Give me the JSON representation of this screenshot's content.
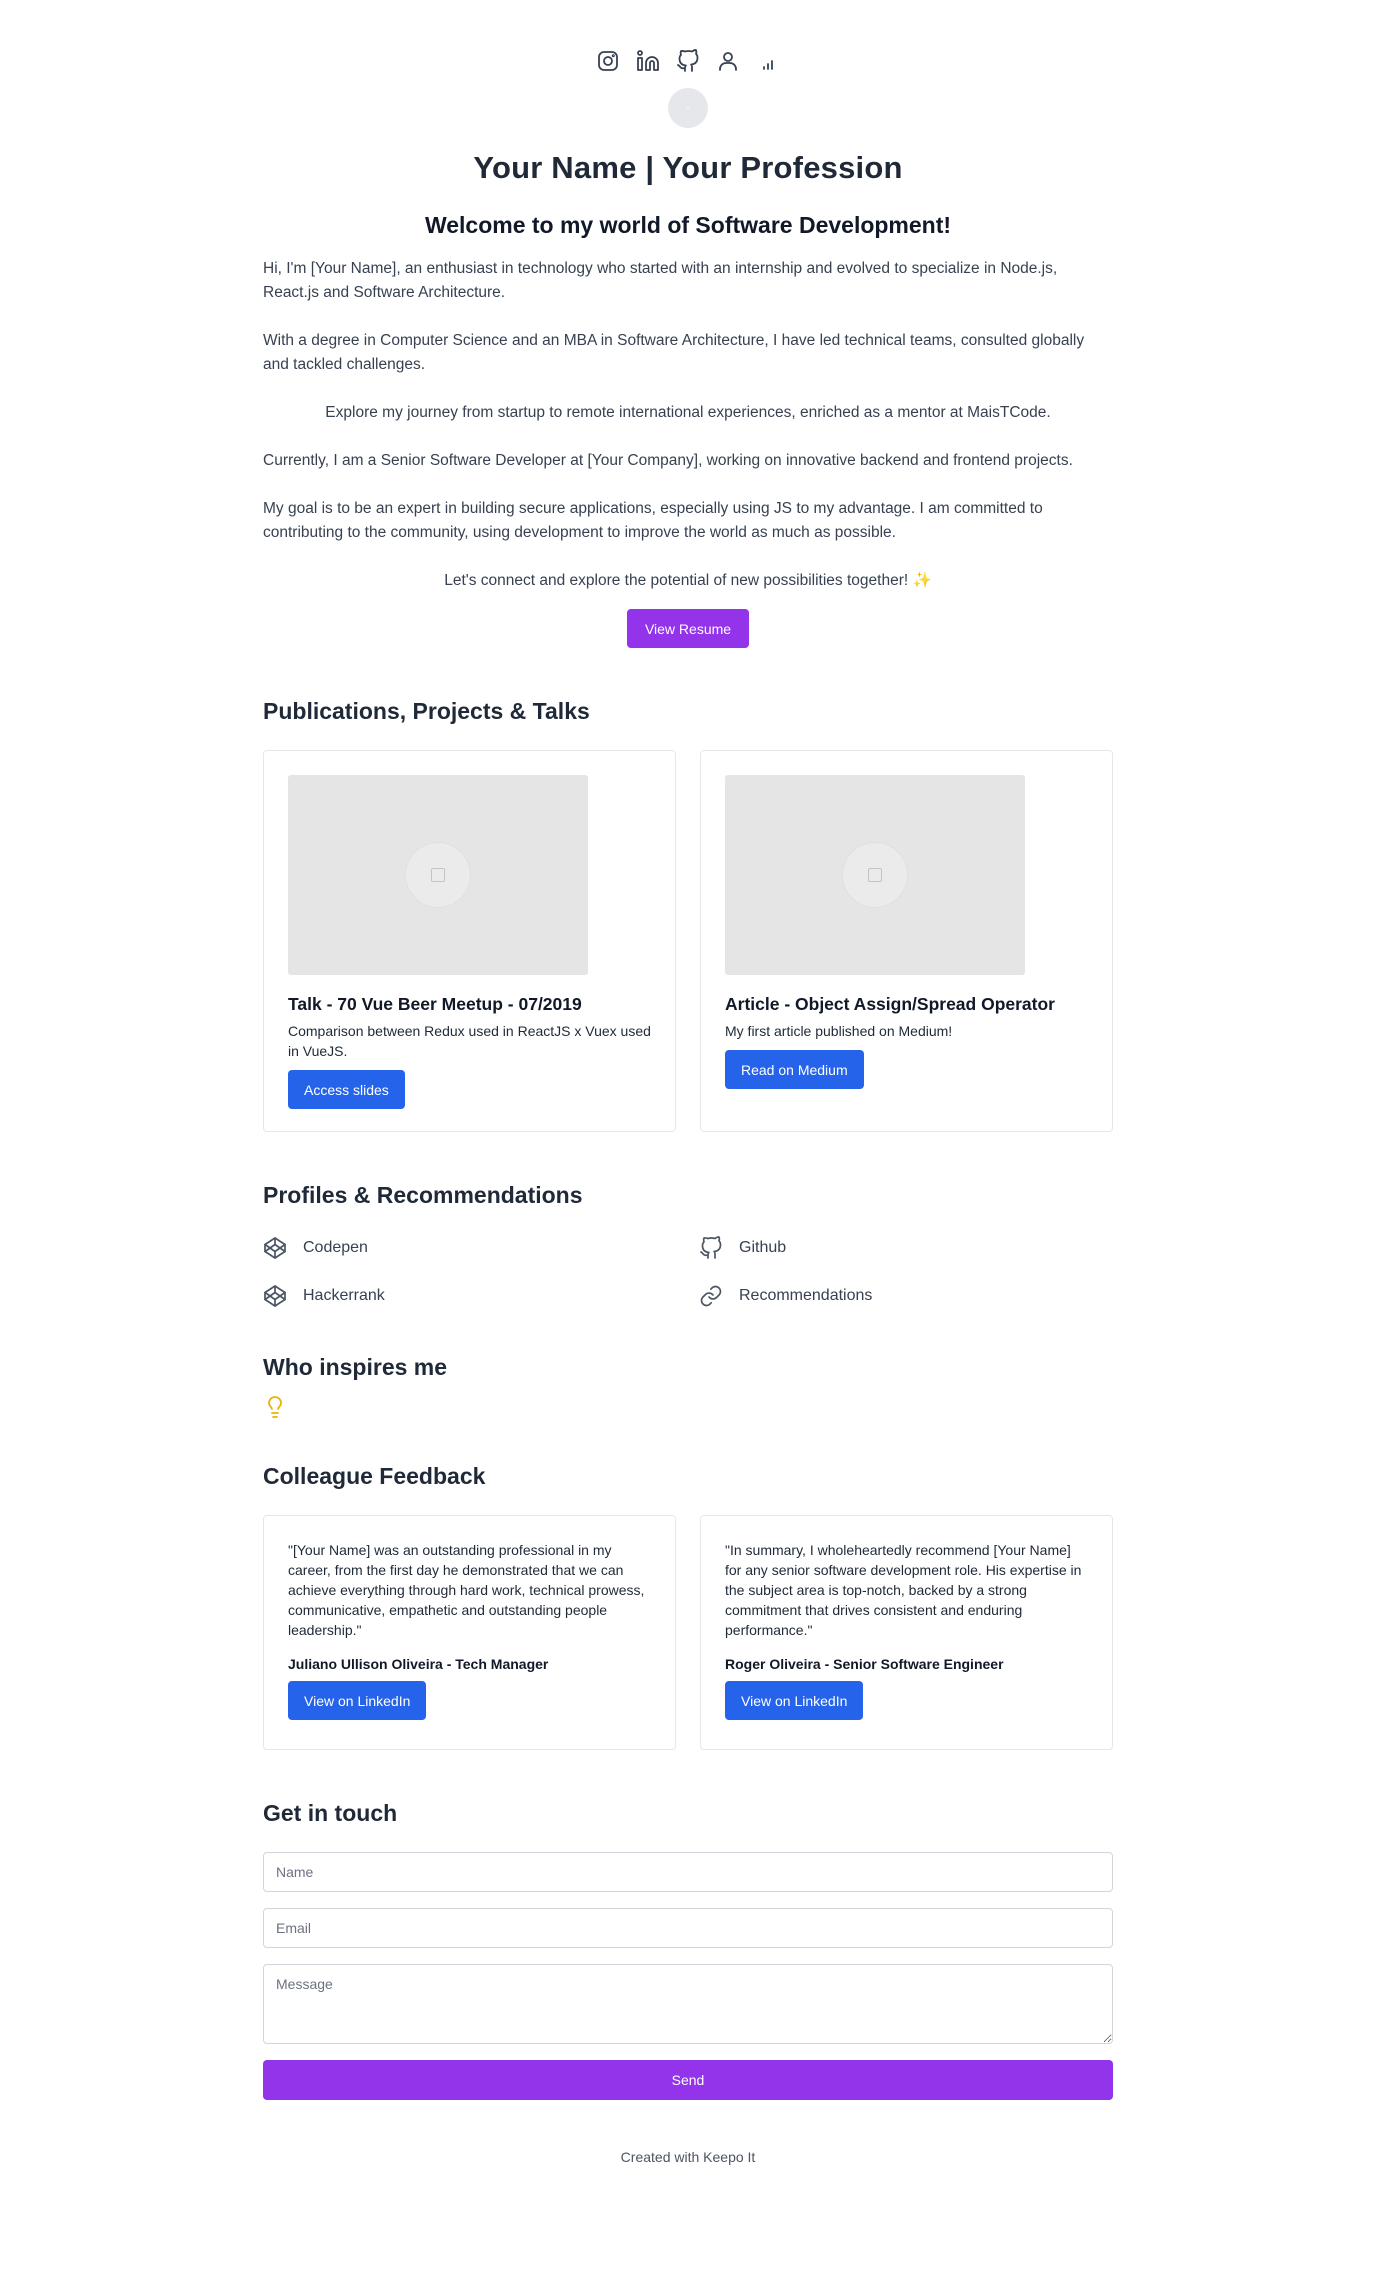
{
  "social": {
    "icons": [
      "instagram-icon",
      "linkedin-icon",
      "github-icon",
      "user-icon",
      "signal-bars-icon"
    ]
  },
  "header": {
    "title": "Your Name | Your Profession",
    "welcome": "Welcome to my world of Software Development!"
  },
  "bio": {
    "p1": "Hi, I'm [Your Name], an enthusiast in technology who started with an internship and evolved to specialize in Node.js, React.js and Software Architecture.",
    "p2": "With a degree in Computer Science and an MBA in Software Architecture, I have led technical teams, consulted globally and tackled challenges.",
    "p3": "Explore my journey from startup to remote international experiences, enriched as a mentor at MaisTCode.",
    "p4": "Currently, I am a Senior Software Developer at [Your Company], working on innovative backend and frontend projects.",
    "p5": "My goal is to be an expert in building secure applications, especially using JS to my advantage. I am committed to contributing to the community, using development to improve the world as much as possible.",
    "p6": "Let's connect and explore the potential of new possibilities together! ✨",
    "resume_label": "View Resume"
  },
  "publications": {
    "heading": "Publications, Projects & Talks",
    "items": [
      {
        "title": "Talk - 70 Vue Beer Meetup - 07/2019",
        "description": "Comparison between Redux used in ReactJS x Vuex used in VueJS.",
        "button": "Access slides"
      },
      {
        "title": "Article - Object Assign/Spread Operator",
        "description": "My first article published on Medium!",
        "button": "Read on Medium"
      }
    ]
  },
  "profiles": {
    "heading": "Profiles & Recommendations",
    "items": [
      {
        "label": "Codepen",
        "icon": "codepen-icon"
      },
      {
        "label": "Github",
        "icon": "github-icon"
      },
      {
        "label": "Hackerrank",
        "icon": "codepen-icon"
      },
      {
        "label": "Recommendations",
        "icon": "link-icon"
      }
    ]
  },
  "inspire": {
    "heading": "Who inspires me",
    "icon": "lightbulb-icon"
  },
  "feedback": {
    "heading": "Colleague Feedback",
    "items": [
      {
        "quote": "\"[Your Name] was an outstanding professional in my career, from the first day he demonstrated that we can achieve everything through hard work, technical prowess, communicative, empathetic and outstanding people leadership.\"",
        "author": "Juliano Ullison Oliveira - Tech Manager",
        "button": "View on LinkedIn"
      },
      {
        "quote": "\"In summary, I wholeheartedly recommend [Your Name] for any senior software development role. His expertise in the subject area is top-notch, backed by a strong commitment that drives consistent and enduring performance.\"",
        "author": "Roger Oliveira - Senior Software Engineer",
        "button": "View on LinkedIn"
      }
    ]
  },
  "contact": {
    "heading": "Get in touch",
    "name_placeholder": "Name",
    "email_placeholder": "Email",
    "message_placeholder": "Message",
    "send_label": "Send"
  },
  "footer": {
    "text": "Created with Keepo It"
  },
  "colors": {
    "purple": "#9333ea",
    "blue": "#2563eb",
    "bulb": "#eab308"
  }
}
